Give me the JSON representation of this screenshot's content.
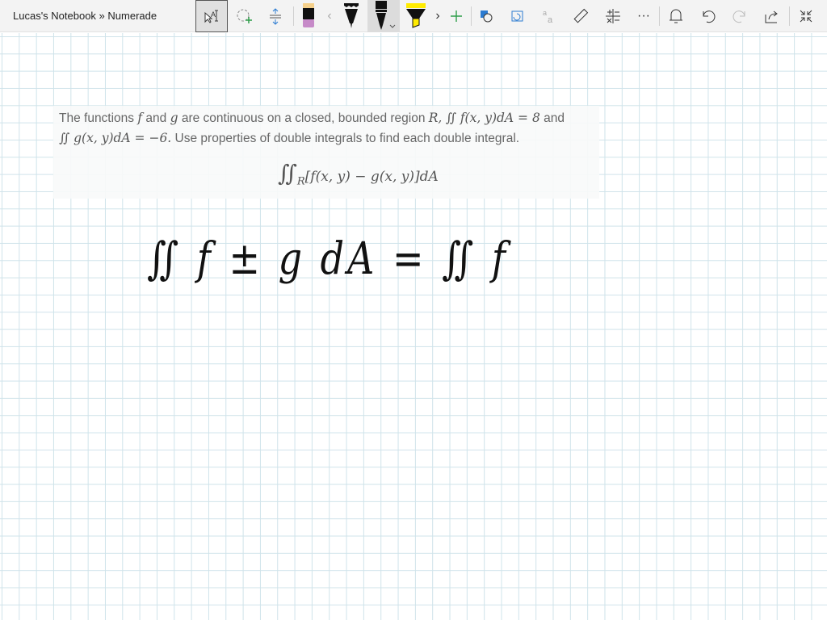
{
  "window": {
    "title": "Lucas's Notebook » Numerade"
  },
  "toolbar": {
    "tools": [
      "select-text",
      "lasso-add",
      "insert-space",
      "eraser",
      "previous",
      "pen-black-thick",
      "pen-black",
      "highlighter-yellow",
      "next",
      "add-pen",
      "shape-to-ink",
      "ink-to-shape",
      "ink-to-text",
      "ruler",
      "math",
      "more",
      "notifications",
      "undo",
      "redo",
      "share",
      "exit-full-screen"
    ],
    "colors": {
      "eraser_tip": "#c68ac8",
      "highlighter": "#ffeb00",
      "accent_green": "#2e9e4a",
      "accent_blue": "#2b7bd1"
    }
  },
  "question": {
    "line1_a": "The functions ",
    "f": "f",
    "and": " and ",
    "g": "g",
    "line1_b": " are continuous on a closed, bounded region ",
    "R": "R,",
    "int_f": "∬ f(x, y)dA = 8",
    "and2": " and",
    "int_g": "∬ g(x, y)dA = −6.",
    "line2": " Use properties of double integrals to find each double integral.",
    "display": "∬",
    "display_sub": "R",
    "display_body": "[f(x, y) − g(x, y)]dA"
  },
  "handwriting": {
    "text": "∬ f ± g dA = ∬ f"
  }
}
